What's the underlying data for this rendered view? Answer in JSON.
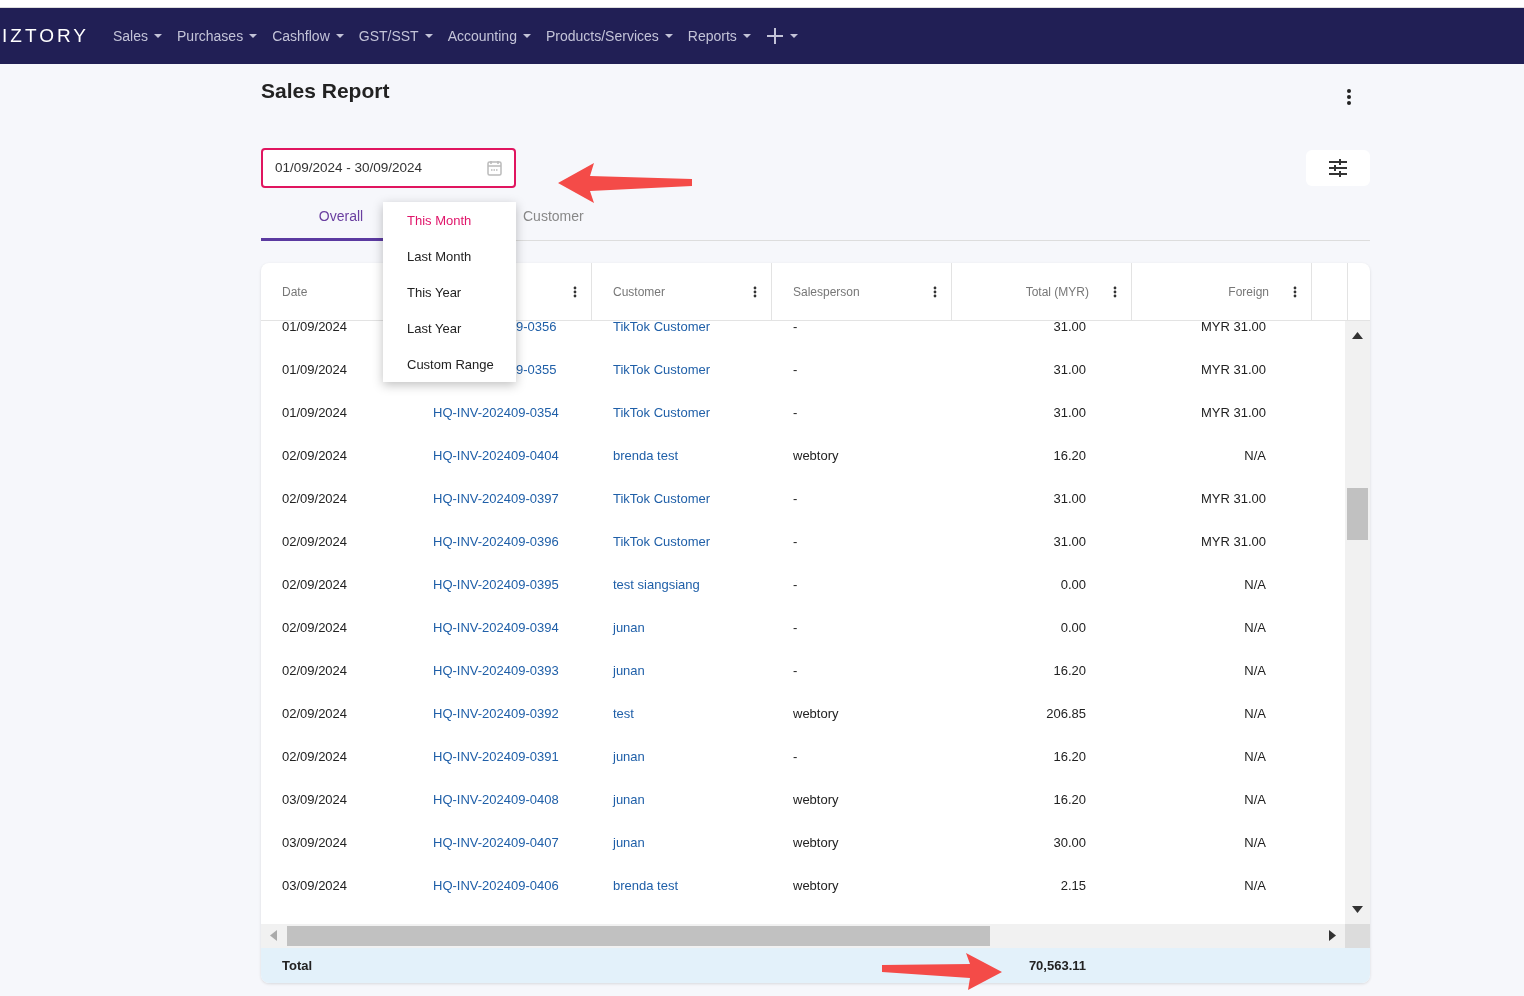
{
  "navbar": {
    "logo": "IZTORY",
    "menus": [
      {
        "label": "Sales"
      },
      {
        "label": "Purchases"
      },
      {
        "label": "Cashflow"
      },
      {
        "label": "GST/SST"
      },
      {
        "label": "Accounting"
      },
      {
        "label": "Products/Services"
      },
      {
        "label": "Reports"
      }
    ]
  },
  "page": {
    "title": "Sales Report"
  },
  "date_range": {
    "value": "01/09/2024 - 30/09/2024",
    "focused": true
  },
  "range_menu": [
    {
      "label": "This Month",
      "selected": true
    },
    {
      "label": "Last Month",
      "selected": false
    },
    {
      "label": "This Year",
      "selected": false
    },
    {
      "label": "Last Year",
      "selected": false
    },
    {
      "label": "Custom Range",
      "selected": false
    }
  ],
  "tabs": [
    {
      "label": "Overall",
      "selected": true
    },
    {
      "label": "Customer",
      "selected": false
    }
  ],
  "table": {
    "columns": [
      {
        "label": "Date",
        "kind": "text"
      },
      {
        "kind": "text",
        "menu_icon": true
      },
      {
        "label": "Customer",
        "kind": "text",
        "menu_icon": true
      },
      {
        "label": "Salesperson",
        "kind": "text",
        "menu_icon": true
      },
      {
        "label": "Total (MYR)",
        "kind": "amount",
        "menu_icon": true
      },
      {
        "label": "Foreign",
        "kind": "amount",
        "menu_icon": true
      }
    ],
    "rows": [
      {
        "date": "01/09/2024",
        "invoice": "9-0356",
        "partly_hidden": true,
        "customer": "TikTok Customer",
        "salesperson": "-",
        "total": "31.00",
        "foreign": "MYR 31.00"
      },
      {
        "date": "01/09/2024",
        "invoice": "9-0355",
        "partly_hidden": true,
        "customer": "TikTok Customer",
        "salesperson": "-",
        "total": "31.00",
        "foreign": "MYR 31.00"
      },
      {
        "date": "01/09/2024",
        "invoice": "HQ-INV-202409-0354",
        "partly_hidden": false,
        "customer": "TikTok Customer",
        "salesperson": "-",
        "total": "31.00",
        "foreign": "MYR 31.00"
      },
      {
        "date": "02/09/2024",
        "invoice": "HQ-INV-202409-0404",
        "partly_hidden": false,
        "customer": "brenda test",
        "salesperson": "webtory",
        "total": "16.20",
        "foreign": "N/A"
      },
      {
        "date": "02/09/2024",
        "invoice": "HQ-INV-202409-0397",
        "partly_hidden": false,
        "customer": "TikTok Customer",
        "salesperson": "-",
        "total": "31.00",
        "foreign": "MYR 31.00"
      },
      {
        "date": "02/09/2024",
        "invoice": "HQ-INV-202409-0396",
        "partly_hidden": false,
        "customer": "TikTok Customer",
        "salesperson": "-",
        "total": "31.00",
        "foreign": "MYR 31.00"
      },
      {
        "date": "02/09/2024",
        "invoice": "HQ-INV-202409-0395",
        "partly_hidden": false,
        "customer": "test siangsiang",
        "salesperson": "-",
        "total": "0.00",
        "foreign": "N/A"
      },
      {
        "date": "02/09/2024",
        "invoice": "HQ-INV-202409-0394",
        "partly_hidden": false,
        "customer": "junan",
        "salesperson": "-",
        "total": "0.00",
        "foreign": "N/A"
      },
      {
        "date": "02/09/2024",
        "invoice": "HQ-INV-202409-0393",
        "partly_hidden": false,
        "customer": "junan",
        "salesperson": "-",
        "total": "16.20",
        "foreign": "N/A"
      },
      {
        "date": "02/09/2024",
        "invoice": "HQ-INV-202409-0392",
        "partly_hidden": false,
        "customer": "test",
        "salesperson": "webtory",
        "total": "206.85",
        "foreign": "N/A"
      },
      {
        "date": "02/09/2024",
        "invoice": "HQ-INV-202409-0391",
        "partly_hidden": false,
        "customer": "junan",
        "salesperson": "-",
        "total": "16.20",
        "foreign": "N/A"
      },
      {
        "date": "03/09/2024",
        "invoice": "HQ-INV-202409-0408",
        "partly_hidden": false,
        "customer": "junan",
        "salesperson": "webtory",
        "total": "16.20",
        "foreign": "N/A"
      },
      {
        "date": "03/09/2024",
        "invoice": "HQ-INV-202409-0407",
        "partly_hidden": false,
        "customer": "junan",
        "salesperson": "webtory",
        "total": "30.00",
        "foreign": "N/A"
      },
      {
        "date": "03/09/2024",
        "invoice": "HQ-INV-202409-0406",
        "partly_hidden": false,
        "customer": "brenda test",
        "salesperson": "webtory",
        "total": "2.15",
        "foreign": "N/A"
      }
    ],
    "total": {
      "label": "Total",
      "value": "70,563.11"
    }
  }
}
